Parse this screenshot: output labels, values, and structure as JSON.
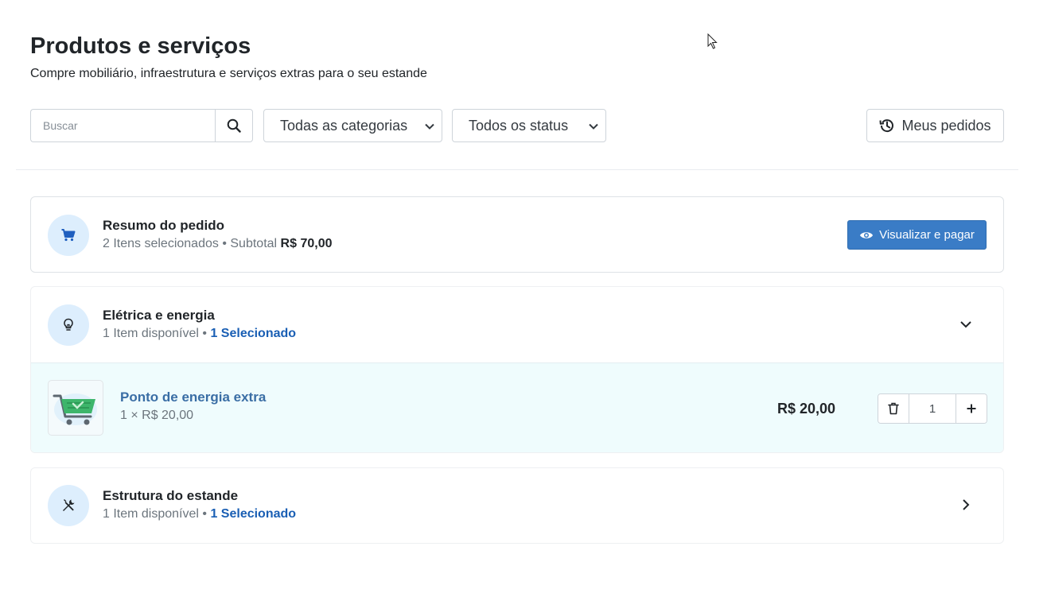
{
  "header": {
    "title": "Produtos e serviços",
    "subtitle": "Compre mobiliário, infraestrutura e serviços extras para o seu estande"
  },
  "toolbar": {
    "search_placeholder": "Buscar",
    "categories_select": "Todas as categorias",
    "status_select": "Todos os status",
    "orders_button": "Meus pedidos"
  },
  "summary": {
    "title": "Resumo do pedido",
    "items_text": "2 Itens selecionados",
    "separator": " • ",
    "subtotal_label": "Subtotal",
    "subtotal_value": "R$ 70,00",
    "pay_button": "Visualizar e pagar",
    "icon": "cart-icon"
  },
  "categories": [
    {
      "title": "Elétrica e energia",
      "available": "1 Item disponível",
      "separator": " • ",
      "selected": "1 Selecionado",
      "icon": "lightbulb-icon",
      "expanded": true,
      "products": [
        {
          "name": "Ponto de energia extra",
          "unit_price": "1 × R$ 20,00",
          "total": "R$ 20,00",
          "quantity": "1",
          "thumbnail": "shopping-cart-image"
        }
      ]
    },
    {
      "title": "Estrutura do estande",
      "available": "1 Item disponível",
      "separator": " • ",
      "selected": "1 Selecionado",
      "icon": "tools-icon",
      "expanded": false
    }
  ],
  "colors": {
    "primary_button": "#3a7cc6",
    "selected_text": "#1a5fb4",
    "product_link": "#3a6ea5",
    "icon_circle": "#ddeefd",
    "product_row_bg": "#effcfd"
  }
}
